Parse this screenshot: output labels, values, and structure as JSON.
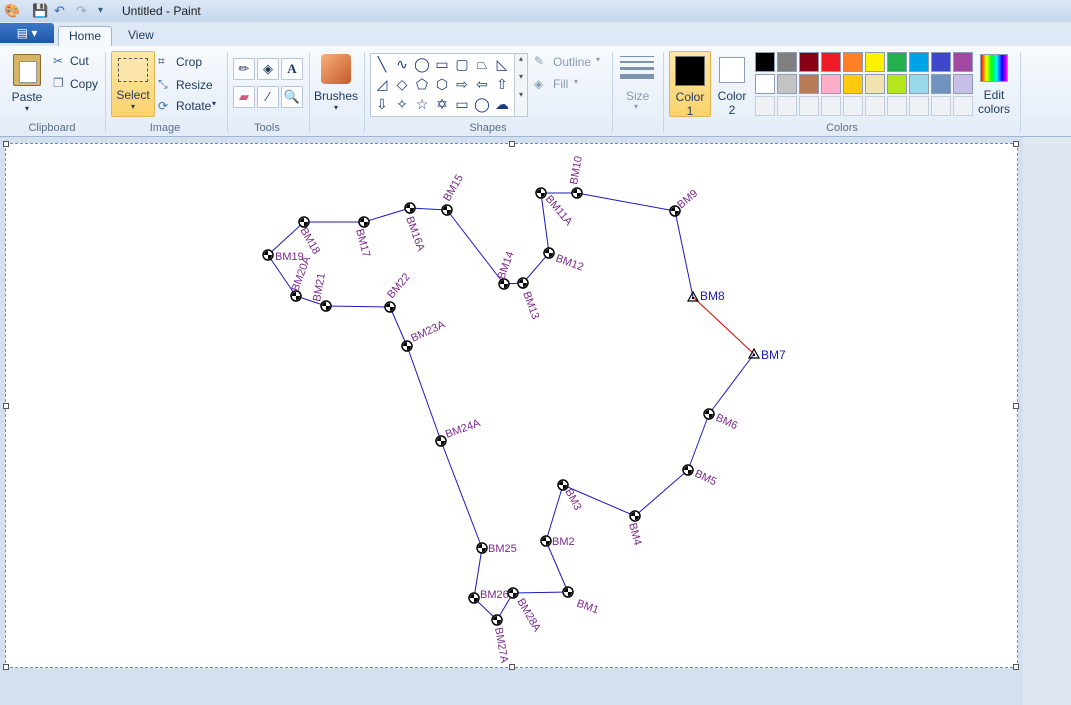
{
  "window": {
    "title": "Untitled - Paint"
  },
  "tabs": {
    "file_icon": "menu-icon",
    "home": "Home",
    "view": "View"
  },
  "clipboard": {
    "paste": "Paste",
    "cut": "Cut",
    "copy": "Copy",
    "label": "Clipboard"
  },
  "image": {
    "select": "Select",
    "crop": "Crop",
    "resize": "Resize",
    "rotate": "Rotate",
    "label": "Image"
  },
  "tools": {
    "label": "Tools"
  },
  "brushes": {
    "label": "Brushes"
  },
  "shapes": {
    "outline": "Outline",
    "fill": "Fill",
    "label": "Shapes"
  },
  "size": {
    "label": "Size"
  },
  "colors": {
    "color1_label": "Color",
    "color1_num": "1",
    "color2_label": "Color",
    "color2_num": "2",
    "edit_label": "Edit",
    "edit_label2": "colors",
    "label": "Colors",
    "color1": "#000000",
    "color2": "#ffffff",
    "palette_row1": [
      "#000000",
      "#7f7f7f",
      "#880015",
      "#ed1c24",
      "#ff7f27",
      "#fff200",
      "#22b14c",
      "#00a2e8",
      "#3f48cc",
      "#a349a4"
    ],
    "palette_row2": [
      "#ffffff",
      "#c3c3c3",
      "#b97a57",
      "#ffaec9",
      "#ffc90e",
      "#efe4b0",
      "#b5e61d",
      "#99d9ea",
      "#7092be",
      "#c8bfe7"
    ]
  },
  "drawing": {
    "label_color": "#7a2a8a",
    "line_color": "#1a1ac0",
    "highlight_color": "#e00000",
    "points": [
      {
        "id": "BM1",
        "label": "BM1"
      },
      {
        "id": "BM2",
        "label": "BM2"
      },
      {
        "id": "BM3",
        "label": "BM3"
      },
      {
        "id": "BM4",
        "label": "BM4"
      },
      {
        "id": "BM5",
        "label": "BM5"
      },
      {
        "id": "BM6",
        "label": "BM6"
      },
      {
        "id": "BM7",
        "label": "BM7"
      },
      {
        "id": "BM8",
        "label": "BM8"
      },
      {
        "id": "BM9",
        "label": "BM9"
      },
      {
        "id": "BM10",
        "label": "BM10"
      },
      {
        "id": "BM11A",
        "label": "BM11A"
      },
      {
        "id": "BM12",
        "label": "BM12"
      },
      {
        "id": "BM13",
        "label": "BM13"
      },
      {
        "id": "BM14",
        "label": "BM14"
      },
      {
        "id": "BM15",
        "label": "BM15"
      },
      {
        "id": "BM16A",
        "label": "BM16A"
      },
      {
        "id": "BM17",
        "label": "BM17"
      },
      {
        "id": "BM18",
        "label": "BM18"
      },
      {
        "id": "BM19",
        "label": "BM19"
      },
      {
        "id": "BM20A",
        "label": "BM20A"
      },
      {
        "id": "BM21",
        "label": "BM21"
      },
      {
        "id": "BM22",
        "label": "BM22"
      },
      {
        "id": "BM23A",
        "label": "BM23A"
      },
      {
        "id": "BM24A",
        "label": "BM24A"
      },
      {
        "id": "BM25",
        "label": "BM25"
      },
      {
        "id": "BM26",
        "label": "BM26"
      },
      {
        "id": "BM27A",
        "label": "BM27A"
      },
      {
        "id": "BM28A",
        "label": "BM28A"
      }
    ]
  }
}
